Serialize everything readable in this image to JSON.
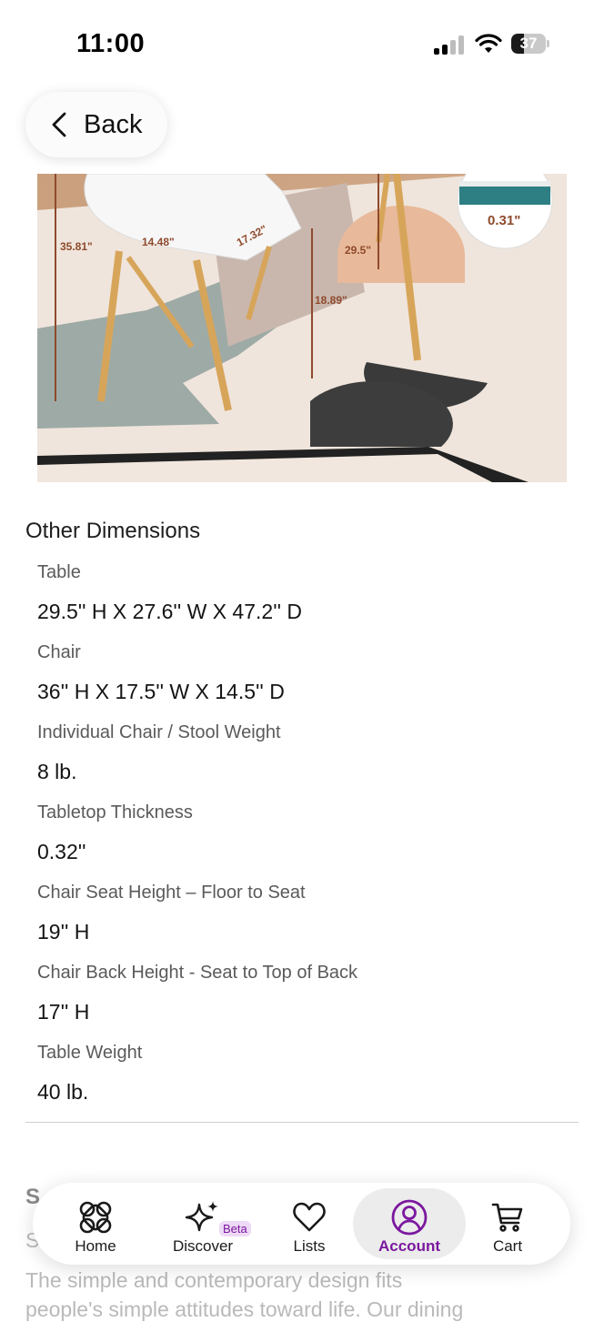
{
  "status_bar": {
    "time": "11:00",
    "battery": "37",
    "battery_level": 0.37
  },
  "header": {
    "back_label": "Back"
  },
  "product_image": {
    "annotations": [
      "35.81\"",
      "14.48\"",
      "17.32\"",
      "29.5\"",
      "18.89\"",
      "0.31\""
    ]
  },
  "dimensions": {
    "title": "Other Dimensions",
    "items": [
      {
        "label": "Table",
        "value": "29.5'' H X 27.6'' W X 47.2'' D"
      },
      {
        "label": "Chair",
        "value": "36'' H X 17.5'' W X 14.5'' D"
      },
      {
        "label": "Individual Chair / Stool Weight",
        "value": "8 lb."
      },
      {
        "label": "Tabletop Thickness",
        "value": "0.32''"
      },
      {
        "label": "Chair Seat Height – Floor to Seat",
        "value": "19'' H"
      },
      {
        "label": "Chair Back Height - Seat to Top of Back",
        "value": "17'' H"
      },
      {
        "label": "Table Weight",
        "value": "40 lb."
      }
    ]
  },
  "below_content": {
    "heading": "S",
    "line1": "S",
    "description": "The simple and contemporary design fits",
    "description2": "people's simple attitudes toward life. Our dining"
  },
  "nav": {
    "items": [
      {
        "label": "Home",
        "icon": "home-icon"
      },
      {
        "label": "Discover",
        "icon": "sparkle-icon",
        "badge": "Beta"
      },
      {
        "label": "Lists",
        "icon": "heart-icon"
      },
      {
        "label": "Account",
        "icon": "account-icon",
        "active": true
      },
      {
        "label": "Cart",
        "icon": "cart-icon"
      }
    ],
    "accent": "#7b189f"
  }
}
